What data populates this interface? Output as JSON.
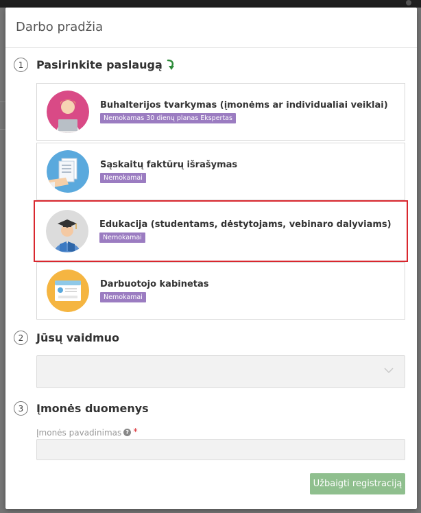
{
  "modal": {
    "title": "Darbo pradžia"
  },
  "steps": [
    {
      "number": "1",
      "title": "Pasirinkite paslaugą"
    },
    {
      "number": "2",
      "title": "Jūsų vaidmuo"
    },
    {
      "number": "3",
      "title": "Įmonės duomenys"
    }
  ],
  "services": [
    {
      "title": "Buhalterijos tvarkymas (įmonėms ar individualiai veiklai)",
      "badge": "Nemokamas 30 dienų planas Ekspertas",
      "icon": "accountant-avatar-icon"
    },
    {
      "title": "Sąskaitų faktūrų išrašymas",
      "badge": "Nemokamai",
      "icon": "invoice-avatar-icon"
    },
    {
      "title": "Edukacija (studentams, dėstytojams, vebinaro dalyviams)",
      "badge": "Nemokamai",
      "icon": "graduate-avatar-icon"
    },
    {
      "title": "Darbuotojo kabinetas",
      "badge": "Nemokamai",
      "icon": "employee-card-avatar-icon"
    }
  ],
  "role_select": {
    "value": ""
  },
  "company": {
    "name_label": "Įmonės pavadinimas",
    "name_value": ""
  },
  "submit_label": "Užbaigti registraciją",
  "colors": {
    "badge": "#9b7cc1",
    "highlight": "#d9272e",
    "submit": "#8fbf8e",
    "arrow": "#2e8b3a"
  }
}
